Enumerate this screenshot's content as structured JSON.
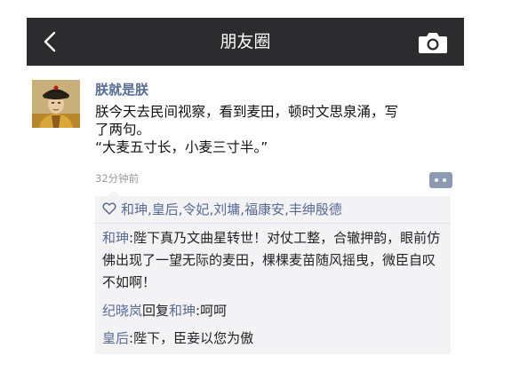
{
  "nav": {
    "back_icon": "chevron-left-icon",
    "title": "朋友圈",
    "camera_icon": "camera-icon"
  },
  "post": {
    "username": "朕就是朕",
    "text_lines": [
      "朕今天去民间视察，看到麦田，顿时文思泉涌，写",
      "了两句。",
      "“大麦五寸长，小麦三寸半。”"
    ],
    "time": "32分钟前",
    "more_icon": "more-dots-icon"
  },
  "likes": {
    "icon": "heart-icon",
    "names": "和珅,皇后,令妃,刘墉,福康安,丰绅殷德"
  },
  "comments": [
    {
      "author": "和珅",
      "sep": ":",
      "text": "陛下真乃文曲星转世！对仗工整，合辙押韵，眼前仿佛出现了一望无际的麦田，棵棵麦苗随风摇曳，微臣自叹不如啊！"
    },
    {
      "author": "纪晓岚",
      "reply_word": "回复",
      "reply_to": "和珅",
      "sep": ":",
      "text": "呵呵"
    },
    {
      "author": "皇后",
      "sep": ":",
      "text": "陛下，臣妾以您为傲"
    }
  ],
  "colors": {
    "navbar": "#2c2c2e",
    "link": "#576b95",
    "comment_bg": "#f3f3f5"
  }
}
